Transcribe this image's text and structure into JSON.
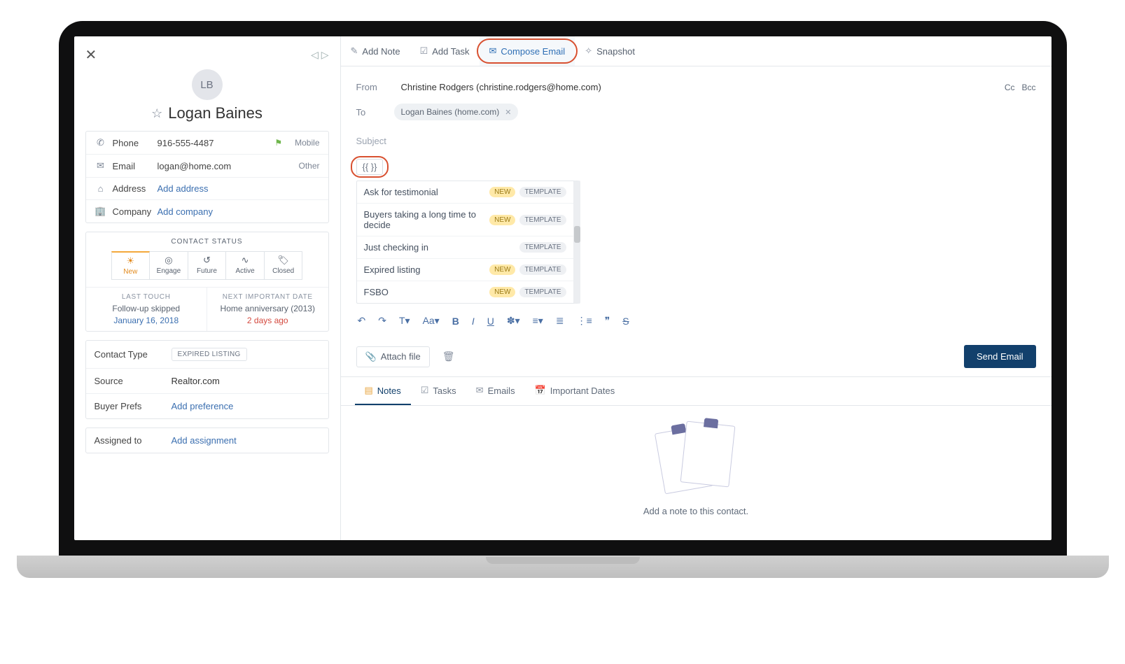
{
  "contact": {
    "initials": "LB",
    "name": "Logan Baines",
    "phone": {
      "label": "Phone",
      "value": "916-555-4487",
      "type": "Mobile"
    },
    "email": {
      "label": "Email",
      "value": "logan@home.com",
      "type": "Other"
    },
    "address": {
      "label": "Address",
      "placeholder": "Add address"
    },
    "company": {
      "label": "Company",
      "placeholder": "Add company"
    }
  },
  "status": {
    "header": "CONTACT STATUS",
    "segments": [
      "New",
      "Engage",
      "Future",
      "Active",
      "Closed"
    ],
    "lastTouch": {
      "header": "LAST TOUCH",
      "line1": "Follow-up skipped",
      "line2": "January 16, 2018"
    },
    "nextDate": {
      "header": "NEXT IMPORTANT DATE",
      "line1": "Home anniversary (2013)",
      "line2": "2 days ago"
    }
  },
  "meta": {
    "contactType": {
      "label": "Contact Type",
      "value": "EXPIRED LISTING"
    },
    "source": {
      "label": "Source",
      "value": "Realtor.com"
    },
    "buyerPrefs": {
      "label": "Buyer Prefs",
      "placeholder": "Add preference"
    },
    "assignedTo": {
      "label": "Assigned to",
      "placeholder": "Add assignment"
    }
  },
  "tabs": {
    "addNote": "Add Note",
    "addTask": "Add Task",
    "composeEmail": "Compose Email",
    "snapshot": "Snapshot"
  },
  "email": {
    "fromLabel": "From",
    "fromValue": "Christine Rodgers (christine.rodgers@home.com)",
    "cc": "Cc",
    "bcc": "Bcc",
    "toLabel": "To",
    "toChip": "Logan Baines (home.com)",
    "subjectPlaceholder": "Subject",
    "merge": "{{  }}",
    "templates": [
      {
        "name": "Ask for testimonial",
        "new": true
      },
      {
        "name": "Buyers taking a long time to decide",
        "new": true
      },
      {
        "name": "Just checking in",
        "new": false
      },
      {
        "name": "Expired listing",
        "new": true
      },
      {
        "name": "FSBO",
        "new": true
      }
    ],
    "templateBadge": "TEMPLATE",
    "newBadge": "NEW",
    "attach": "Attach file",
    "send": "Send Email"
  },
  "lowerTabs": {
    "notes": "Notes",
    "tasks": "Tasks",
    "emails": "Emails",
    "dates": "Important Dates",
    "emptyText": "Add a note to this contact."
  }
}
